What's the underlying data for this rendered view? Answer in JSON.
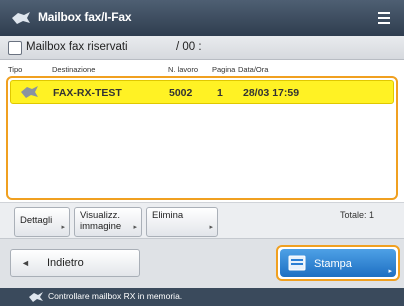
{
  "titlebar": {
    "title": "Mailbox fax/I-Fax",
    "icon": "fax-icon",
    "menu_icon": "hamburger-menu-icon"
  },
  "subheader": {
    "box_name": "Mailbox fax riservati",
    "count": "/ 00 :"
  },
  "columns": {
    "type": "Tipo",
    "destination": "Destinazione",
    "job_no": "N. lavoro",
    "pages": "Pagina",
    "datetime": "Data/Ora"
  },
  "rows": [
    {
      "icon": "fax-receive-icon",
      "destination": "FAX-RX-TEST",
      "job_no": "5002",
      "pages": "1",
      "datetime": "28/03  17:59",
      "selected": true
    }
  ],
  "buttons": {
    "details": "Dettagli",
    "preview_line1": "Visualizz.",
    "preview_line2": "immagine",
    "delete": "Elimina",
    "arrow": "▸",
    "total": "Totale: 1"
  },
  "nav": {
    "back": "Indietro",
    "back_icon": "◄",
    "print": "Stampa",
    "print_arrow": "▸"
  },
  "status": {
    "text": "Controllare mailbox RX in memoria."
  },
  "colors": {
    "accent": "#f0a020",
    "selected_row": "#fff224",
    "primary_button": "#2b7fd4",
    "titlebar": "#3a4a5c"
  }
}
